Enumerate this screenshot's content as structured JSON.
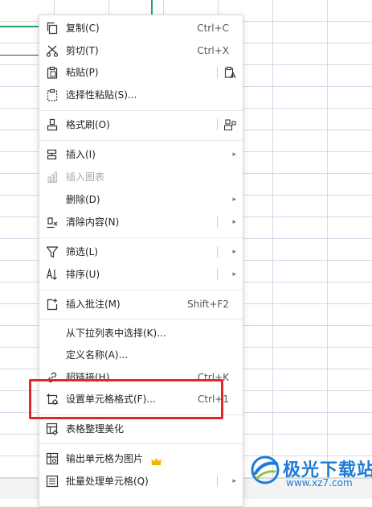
{
  "menu": {
    "items": [
      {
        "key": "copy",
        "label": "复制(C)",
        "shortcut": "Ctrl+C",
        "icon": "copy-icon"
      },
      {
        "key": "cut",
        "label": "剪切(T)",
        "shortcut": "Ctrl+X",
        "icon": "scissors-icon"
      },
      {
        "key": "paste",
        "label": "粘贴(P)",
        "icon": "paste-icon",
        "right_icon": "paste-format-icon"
      },
      {
        "key": "paste-special",
        "label": "选择性粘贴(S)...",
        "icon": "paste-special-icon"
      },
      {
        "key": "format-painter",
        "label": "格式刷(O)",
        "icon": "format-painter-icon",
        "right_icon": "format-painter-extra-icon"
      },
      {
        "key": "insert",
        "label": "插入(I)",
        "icon": "insert-icon",
        "submenu": true
      },
      {
        "key": "insert-chart",
        "label": "插入图表",
        "icon": "chart-icon",
        "disabled": true
      },
      {
        "key": "delete",
        "label": "删除(D)",
        "submenu": true
      },
      {
        "key": "clear",
        "label": "清除内容(N)",
        "icon": "eraser-icon",
        "submenu": true
      },
      {
        "key": "filter",
        "label": "筛选(L)",
        "icon": "filter-icon",
        "submenu": true
      },
      {
        "key": "sort",
        "label": "排序(U)",
        "icon": "sort-icon",
        "submenu": true
      },
      {
        "key": "comment",
        "label": "插入批注(M)",
        "shortcut": "Shift+F2",
        "icon": "comment-icon"
      },
      {
        "key": "dropdown-pick",
        "label": "从下拉列表中选择(K)..."
      },
      {
        "key": "define-name",
        "label": "定义名称(A)..."
      },
      {
        "key": "hyperlink",
        "label": "超链接(H)...",
        "shortcut": "Ctrl+K",
        "icon": "link-icon"
      },
      {
        "key": "format-cells",
        "label": "设置单元格格式(F)...",
        "shortcut": "Ctrl+1",
        "icon": "cell-format-icon"
      },
      {
        "key": "beautify",
        "label": "表格整理美化",
        "icon": "table-beautify-icon"
      },
      {
        "key": "export-image",
        "label": "输出单元格为图片",
        "icon": "image-export-icon",
        "badge": "crown-icon"
      },
      {
        "key": "batch",
        "label": "批量处理单元格(Q)",
        "icon": "batch-icon",
        "submenu": true
      }
    ],
    "submenu_arrow": "▸"
  },
  "watermark": {
    "title": "极光下载站",
    "url": "www.xz7.com",
    "logo": "aurora-logo-icon"
  },
  "colors": {
    "selection_green": "#21a366",
    "highlight_red": "#e02828",
    "watermark_blue": "#1e7bd6",
    "crown": "#f5b400"
  }
}
